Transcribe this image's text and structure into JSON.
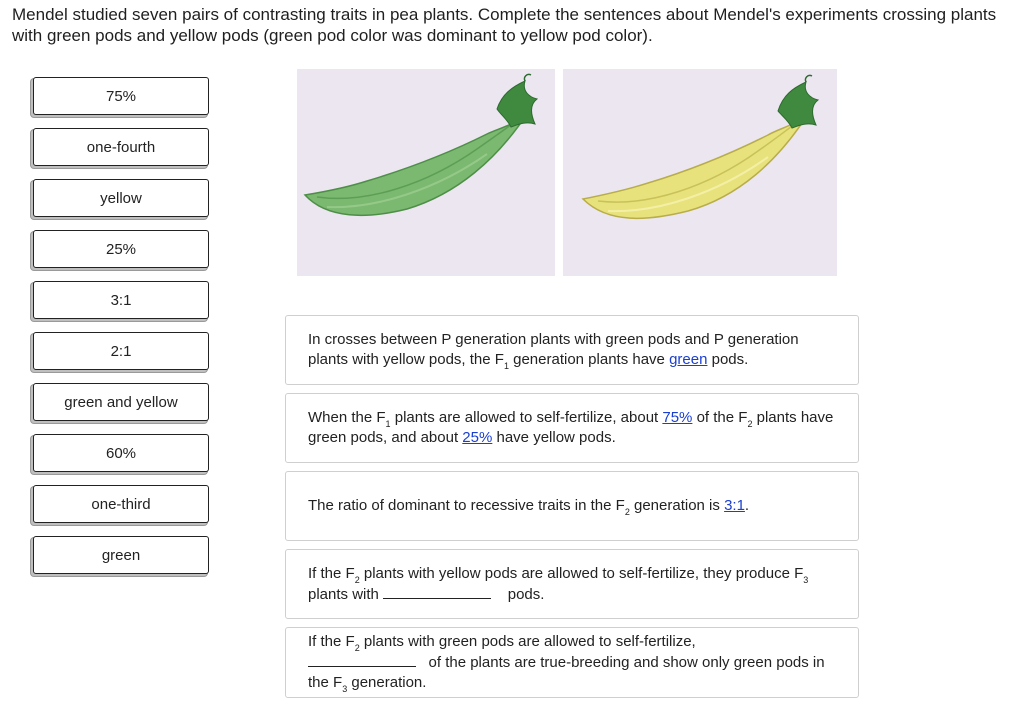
{
  "question": "Mendel studied seven pairs of contrasting traits in pea plants. Complete the sentences about Mendel's experiments crossing plants with green pods and yellow pods (green pod color was dominant to yellow pod color).",
  "choices": [
    "75%",
    "one-fourth",
    "yellow",
    "25%",
    "3:1",
    "2:1",
    "green and yellow",
    "60%",
    "one-third",
    "green"
  ],
  "images": {
    "left_pod_color": "#7bb870",
    "right_pod_color": "#e8e27c",
    "panel_bg": "#ece6f1"
  },
  "sentences": {
    "s1": {
      "part1": "In crosses between P generation plants with green pods and P generation plants with yellow pods, the F",
      "sub1": "1",
      "part2": " generation plants have ",
      "answer": "green",
      "part3": " pods."
    },
    "s2": {
      "part1": "When the F",
      "sub1": "1",
      "part2": " plants are allowed to self-fertilize, about ",
      "answer1": "75%",
      "part3": " of the F",
      "sub2": "2",
      "part4": " plants have green pods, and about ",
      "answer2": "25%",
      "part5": " have yellow pods."
    },
    "s3": {
      "part1": "The ratio of dominant to recessive traits in the F",
      "sub1": "2",
      "part2": " generation is ",
      "answer": "3:1",
      "part3": "."
    },
    "s4": {
      "part1": "If the F",
      "sub1": "2",
      "part2": " plants with yellow pods are allowed to self-fertilize, they produce F",
      "sub2": "3",
      "part3": " plants with ",
      "part4": " pods."
    },
    "s5": {
      "part1": "If the F",
      "sub1": "2",
      "part2": " plants with green pods are allowed to self-fertilize, ",
      "part3": " of the plants are true-breeding and show only green pods in the F",
      "sub2": "3",
      "part4": " generation."
    }
  }
}
